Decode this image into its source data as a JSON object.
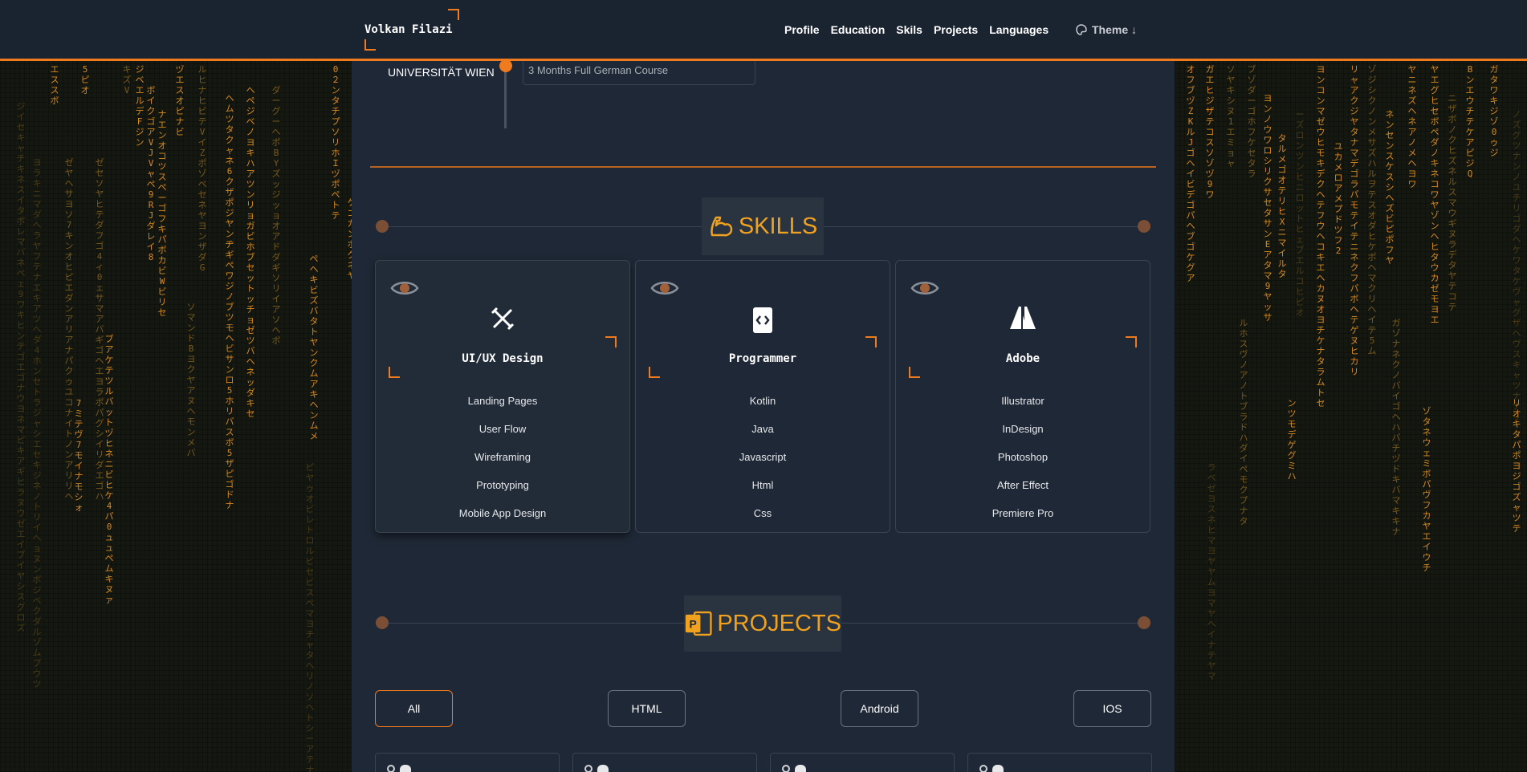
{
  "header": {
    "brand": "Volkan Filazi",
    "nav": [
      "Profile",
      "Education",
      "Skils",
      "Projects",
      "Languages"
    ],
    "theme_label": "Theme ↓"
  },
  "education": {
    "institution": "UNIVERSITÄT WIEN",
    "course": "3 Months Full German Course"
  },
  "skills_section": {
    "title": "SKILLS"
  },
  "skills": [
    {
      "title": "UI/UX Design",
      "items": [
        "Landing Pages",
        "User Flow",
        "Wireframing",
        "Prototyping",
        "Mobile App Design"
      ]
    },
    {
      "title": "Programmer",
      "items": [
        "Kotlin",
        "Java",
        "Javascript",
        "Html",
        "Css"
      ]
    },
    {
      "title": "Adobe",
      "items": [
        "Illustrator",
        "InDesign",
        "Photoshop",
        "After Effect",
        "Premiere Pro"
      ]
    }
  ],
  "projects_section": {
    "title": "PROJECTS"
  },
  "filters": [
    "All",
    "HTML",
    "Android",
    "IOS"
  ],
  "colors": {
    "accent": "#f07a1e",
    "title": "#f0a21e",
    "panel": "#1f2836",
    "header": "#1a2330"
  }
}
